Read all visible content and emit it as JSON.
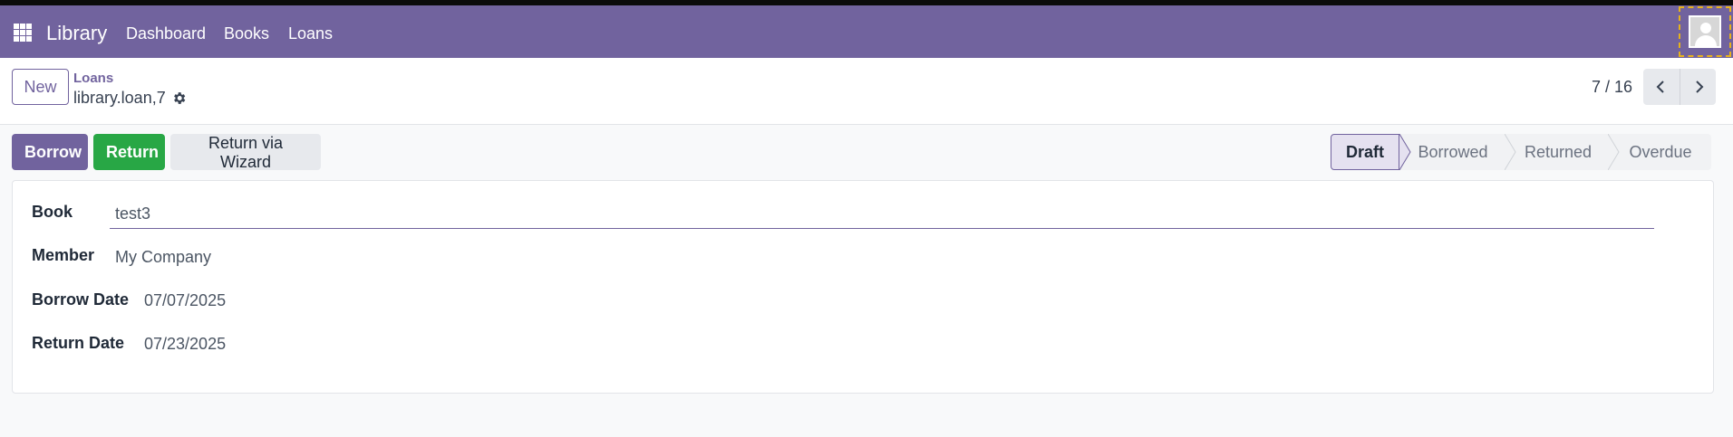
{
  "navbar": {
    "brand": "Library",
    "items": [
      {
        "label": "Dashboard"
      },
      {
        "label": "Books"
      },
      {
        "label": "Loans"
      }
    ]
  },
  "control": {
    "new_label": "New",
    "breadcrumb_parent": "Loans",
    "record_name": "library.loan,7",
    "pager": "7 / 16"
  },
  "actions": {
    "borrow": "Borrow",
    "return": "Return",
    "return_wizard": "Return via Wizard"
  },
  "status": {
    "stages": [
      "Draft",
      "Borrowed",
      "Returned",
      "Overdue"
    ],
    "active": "Draft"
  },
  "form": {
    "book_label": "Book",
    "book_value": "test3",
    "member_label": "Member",
    "member_value": "My Company",
    "borrow_date_label": "Borrow Date",
    "borrow_date_value": "07/07/2025",
    "return_date_label": "Return Date",
    "return_date_value": "07/23/2025"
  },
  "colors": {
    "brand": "#71639e",
    "success": "#28a745"
  }
}
